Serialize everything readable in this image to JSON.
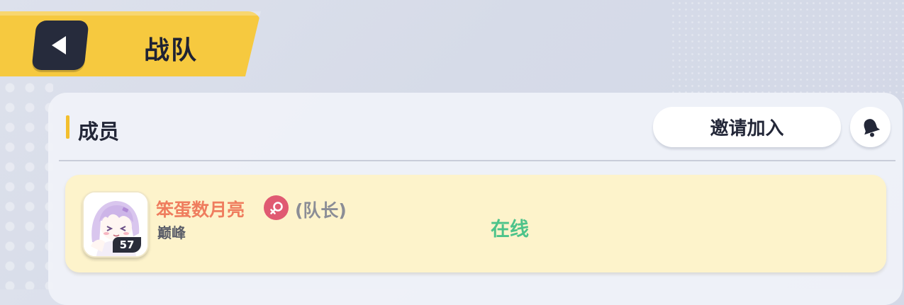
{
  "header": {
    "title": "战队",
    "back_icon": "back-arrow-icon"
  },
  "section": {
    "title": "成员"
  },
  "toolbar": {
    "invite_label": "邀请加入",
    "notify_icon": "bell-icon"
  },
  "members": [
    {
      "name": "笨蛋数月亮",
      "gender_icon": "female-symbol-icon",
      "role": "(队长)",
      "rank": "巅峰",
      "level": "57",
      "status": "在线",
      "status_color": "#4cc38a"
    }
  ],
  "colors": {
    "accent": "#f6c93f",
    "card_bg": "#fdf3cb",
    "name": "#ef7d5e",
    "gender_badge": "#e05a72"
  }
}
